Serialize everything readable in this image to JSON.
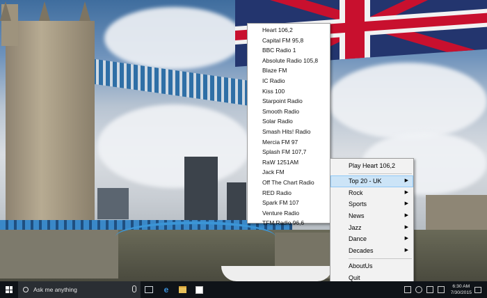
{
  "station_list": {
    "items": [
      "Heart 106,2",
      "Capital FM 95,8",
      "BBC Radio 1",
      "Absolute Radio 105,8",
      "Blaze FM",
      "IC Radio",
      "Kiss 100",
      "Starpoint Radio",
      "Smooth Radio",
      "Solar Radio",
      "Smash Hits! Radio",
      "Mercia FM 97",
      "Splash FM 107,7",
      "RaW 1251AM",
      "Jack FM",
      "Off The Chart Radio",
      "RED Radio",
      "Spark FM 107",
      "Venture Radio",
      "TFM Radio 96,6"
    ]
  },
  "context_menu": {
    "play": "Play Heart 106,2",
    "top20": "Top 20 - UK",
    "rock": "Rock",
    "sports": "Sports",
    "news": "News",
    "jazz": "Jazz",
    "dance": "Dance",
    "decades": "Decades",
    "about": "AboutUs",
    "quit": "Quit",
    "submenu_arrow": "▶",
    "selected_color": "#cce4f7"
  },
  "taskbar": {
    "search_placeholder": "Ask me anything",
    "clock_time": "6:30 AM",
    "clock_date": "7/30/2015"
  }
}
